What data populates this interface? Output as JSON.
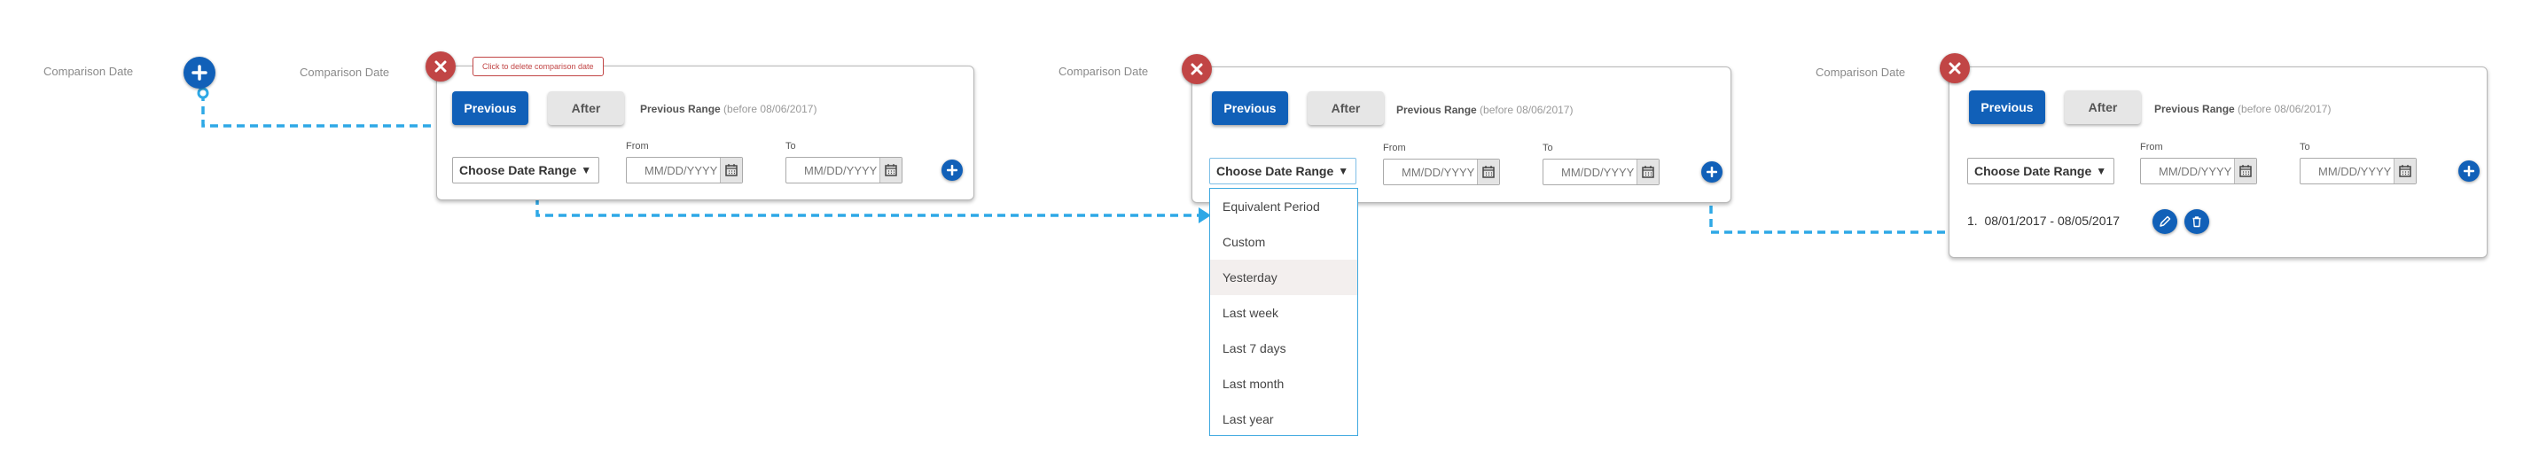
{
  "comparison_label": "Comparison Date",
  "tooltip": "Click to delete comparison date",
  "buttons": {
    "previous": "Previous",
    "after": "After"
  },
  "range": {
    "label": "Previous Range",
    "note": "(before 08/06/2017)"
  },
  "select": {
    "value": "Choose Date Range",
    "arrow": "▼"
  },
  "fields": {
    "from_label": "From",
    "to_label": "To",
    "placeholder": "MM/DD/YYYY"
  },
  "dropdown": {
    "items": [
      "Equivalent Period",
      "Custom",
      "Yesterday",
      "Last week",
      "Last 7 days",
      "Last month",
      "Last year"
    ],
    "highlighted_index": 2
  },
  "result": {
    "index": "1.",
    "range": "08/01/2017 - 08/05/2017"
  },
  "icons": {
    "add": "plus-icon",
    "close": "close-icon",
    "calendar": "calendar-icon",
    "edit": "pencil-icon",
    "delete": "trash-icon"
  },
  "colors": {
    "primary": "#1160b8",
    "danger": "#c14545",
    "connector": "#2ea8e6"
  }
}
